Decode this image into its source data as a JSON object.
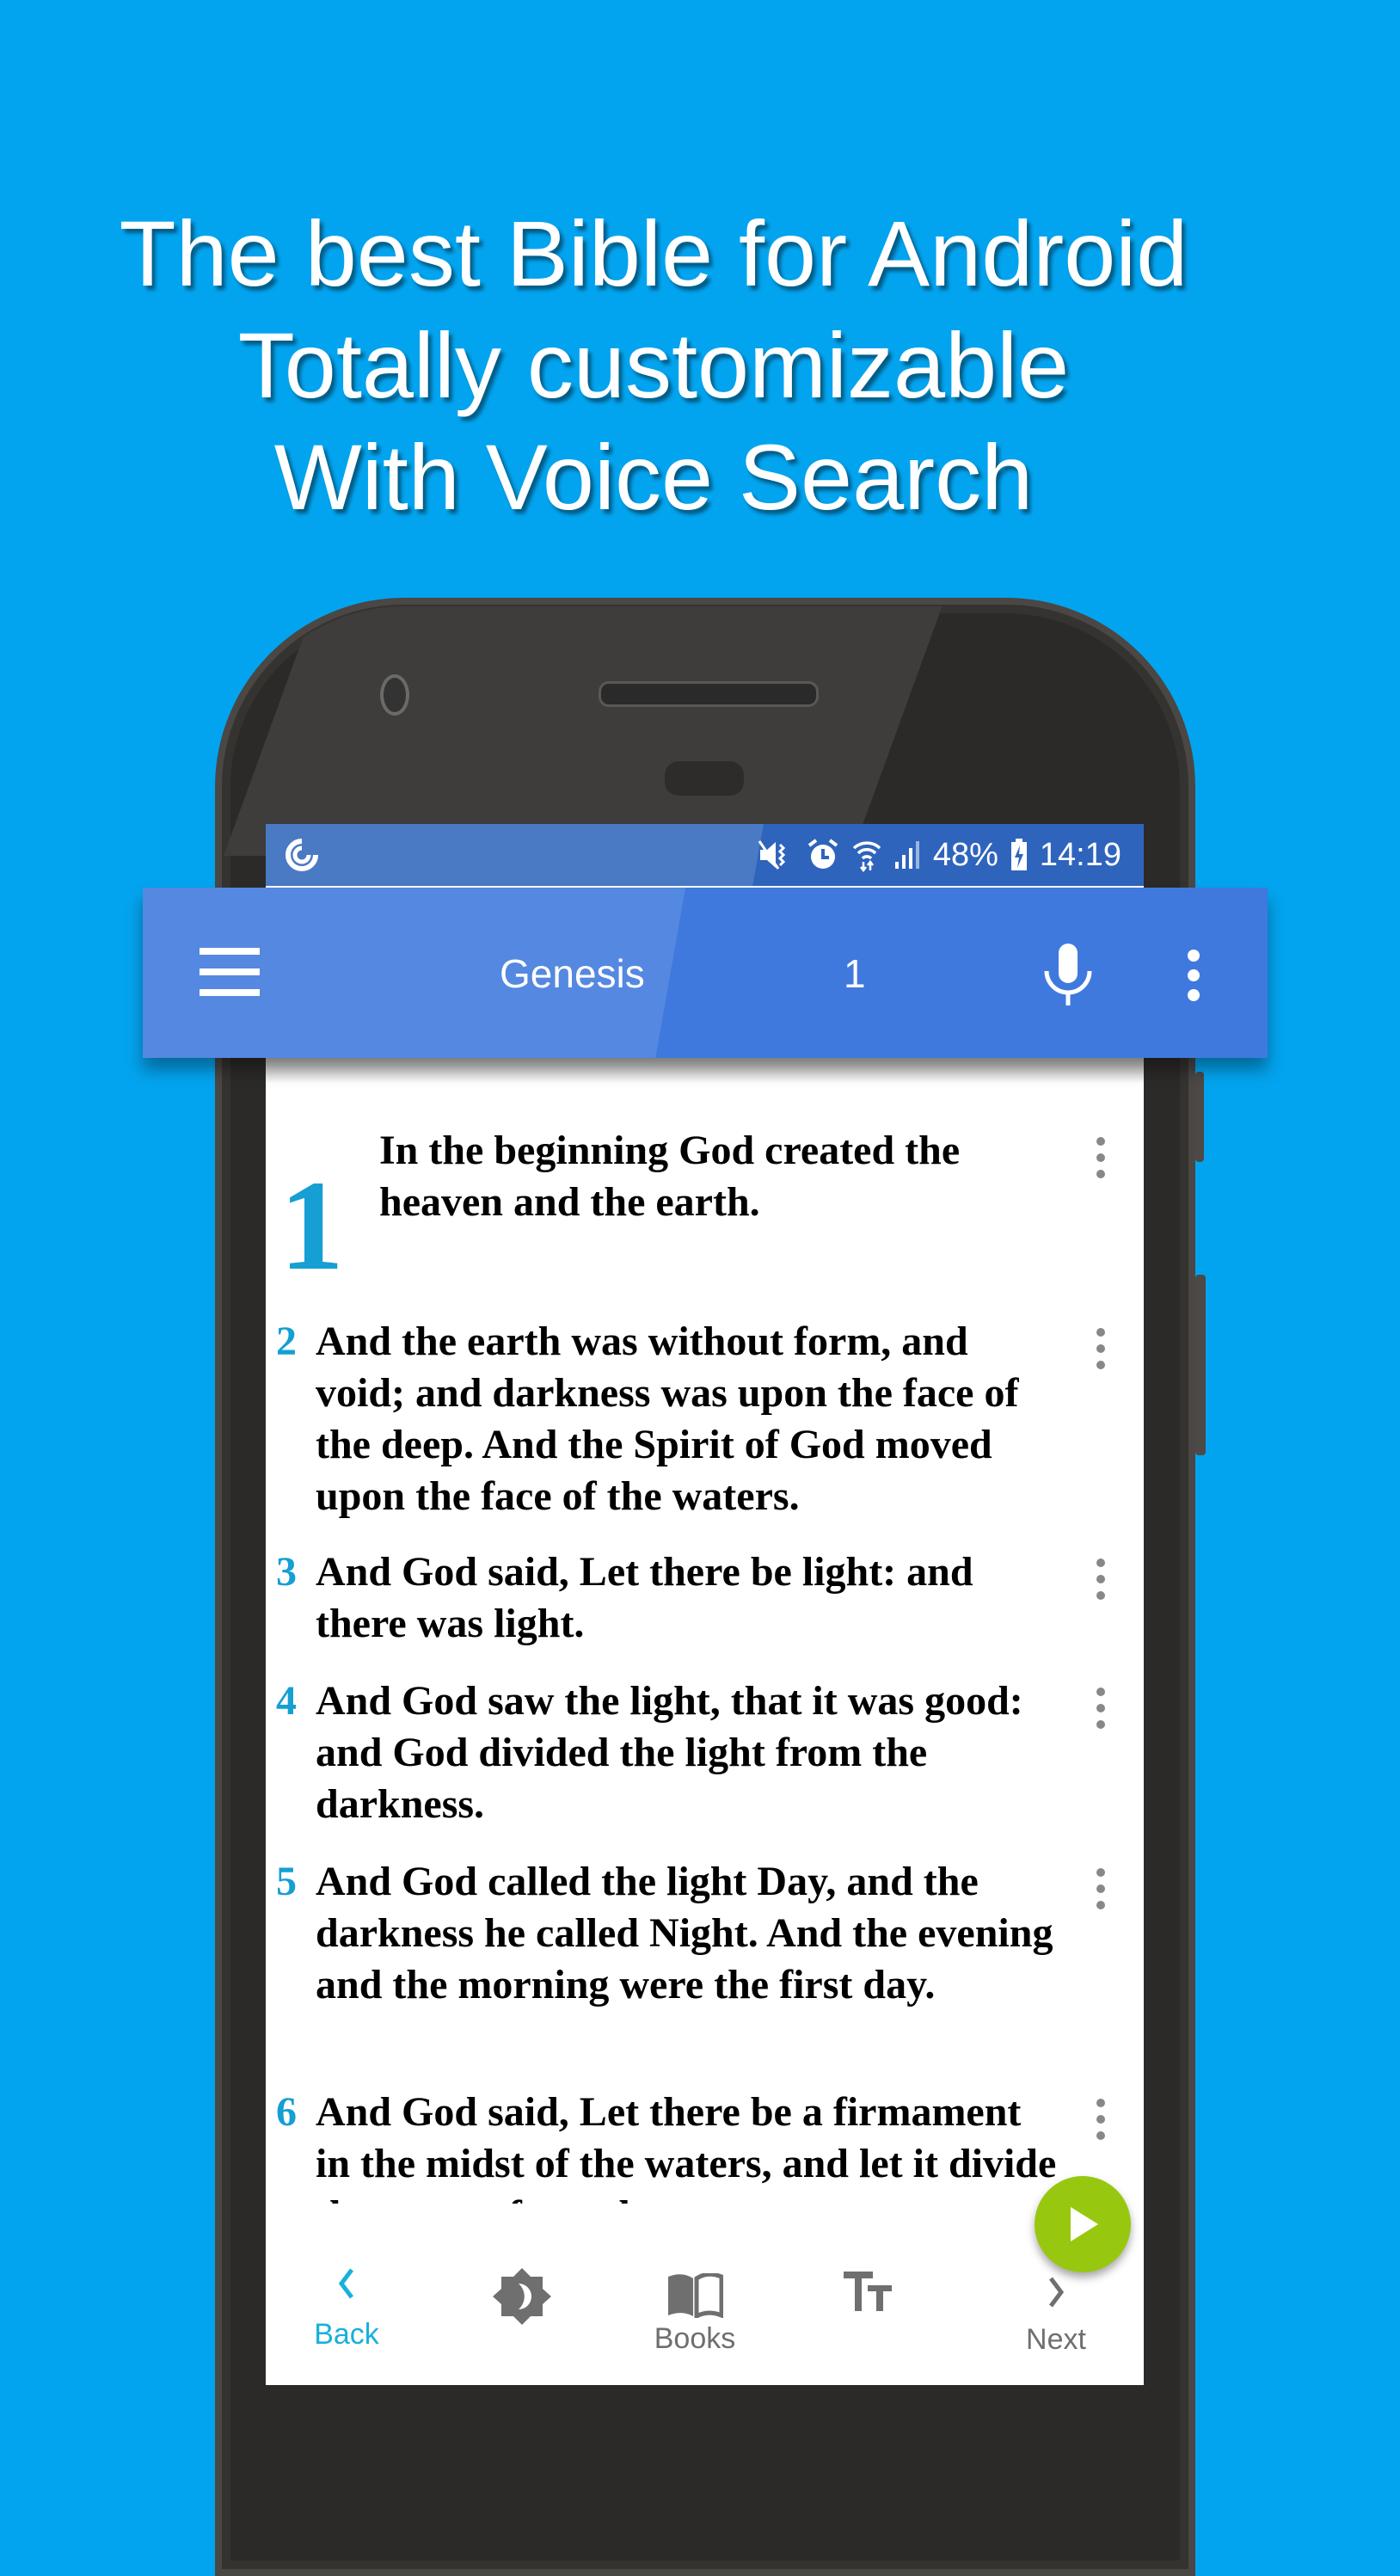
{
  "promo": {
    "lines": [
      "The best Bible for Android",
      "Totally customizable",
      "With Voice Search"
    ]
  },
  "status_bar": {
    "left_icon": "app-notification-icon",
    "icons": [
      "mute-vibrate-icon",
      "alarm-icon",
      "wifi-data-icon",
      "cell-signal-icon"
    ],
    "battery_percent": "48%",
    "battery_icon": "battery-charging-icon",
    "time": "14:19"
  },
  "app_bar": {
    "menu_icon": "hamburger-menu-icon",
    "book": "Genesis",
    "chapter": "1",
    "mic_icon": "microphone-icon",
    "overflow_icon": "more-vert-icon",
    "color": "#4a80df"
  },
  "verses": [
    {
      "num": "1",
      "text": "In the beginning God created the heaven and the earth."
    },
    {
      "num": "2",
      "text": "And the earth was without form, and void; and darkness was upon the face of the deep. And the Spirit of God moved upon the face of the waters."
    },
    {
      "num": "3",
      "text": "And God said, Let there be light: and there was light."
    },
    {
      "num": "4",
      "text": "And God saw the light, that it was good: and God divided the light from the darkness."
    },
    {
      "num": "5",
      "text": "And God called the light Day, and the darkness he called Night. And the evening and the morning were the first day."
    },
    {
      "num": "6",
      "text": "And God said, Let there be a firmament in the midst of the waters, and let it divide the waters from the waters."
    }
  ],
  "verse_number_color": "#159fd2",
  "play_button": {
    "icon": "play-icon",
    "color": "#97c80f"
  },
  "bottom_nav": {
    "items": [
      {
        "id": "back",
        "label": "Back",
        "icon": "chevron-left-icon",
        "active": true
      },
      {
        "id": "night-mode",
        "label": "",
        "icon": "brightness-night-icon",
        "active": false
      },
      {
        "id": "books",
        "label": "Books",
        "icon": "open-book-icon",
        "active": false
      },
      {
        "id": "text-size",
        "label": "",
        "icon": "text-size-icon",
        "active": false
      },
      {
        "id": "next",
        "label": "Next",
        "icon": "chevron-right-icon",
        "active": false
      }
    ],
    "active_color": "#18b0dd",
    "inactive_color": "#6f6f6f"
  }
}
